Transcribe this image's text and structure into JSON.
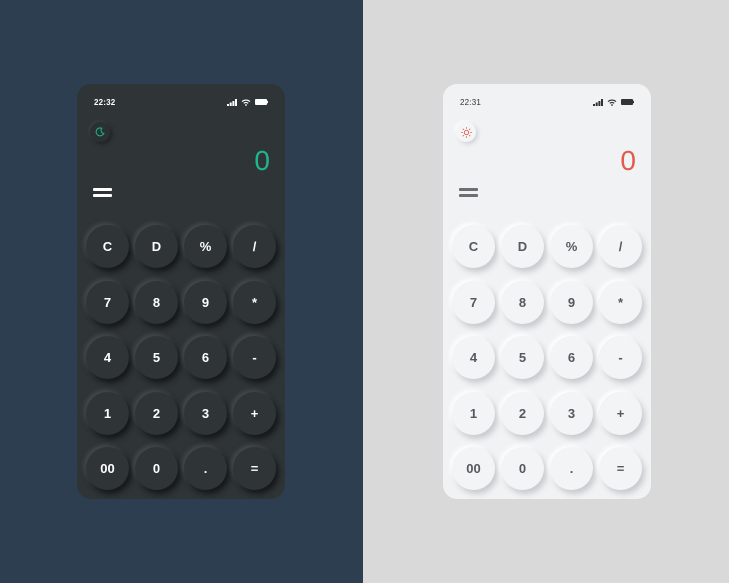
{
  "dark": {
    "status": {
      "time": "22:32"
    },
    "theme_toggle_icon": "moon-icon",
    "display_value": "0",
    "accent_color": "#1fb58d",
    "keys": [
      "C",
      "D",
      "%",
      "/",
      "7",
      "8",
      "9",
      "*",
      "4",
      "5",
      "6",
      "-",
      "1",
      "2",
      "3",
      "+",
      "00",
      "0",
      ".",
      "="
    ]
  },
  "light": {
    "status": {
      "time": "22:31"
    },
    "theme_toggle_icon": "sun-icon",
    "display_value": "0",
    "accent_color": "#e05a4d",
    "keys": [
      "C",
      "D",
      "%",
      "/",
      "7",
      "8",
      "9",
      "*",
      "4",
      "5",
      "6",
      "-",
      "1",
      "2",
      "3",
      "+",
      "00",
      "0",
      ".",
      "="
    ]
  },
  "colors": {
    "dark_background": "#2d3e50",
    "light_background": "#d9d9d9",
    "dark_phone": "#2f3437",
    "light_phone": "#f1f2f4"
  }
}
